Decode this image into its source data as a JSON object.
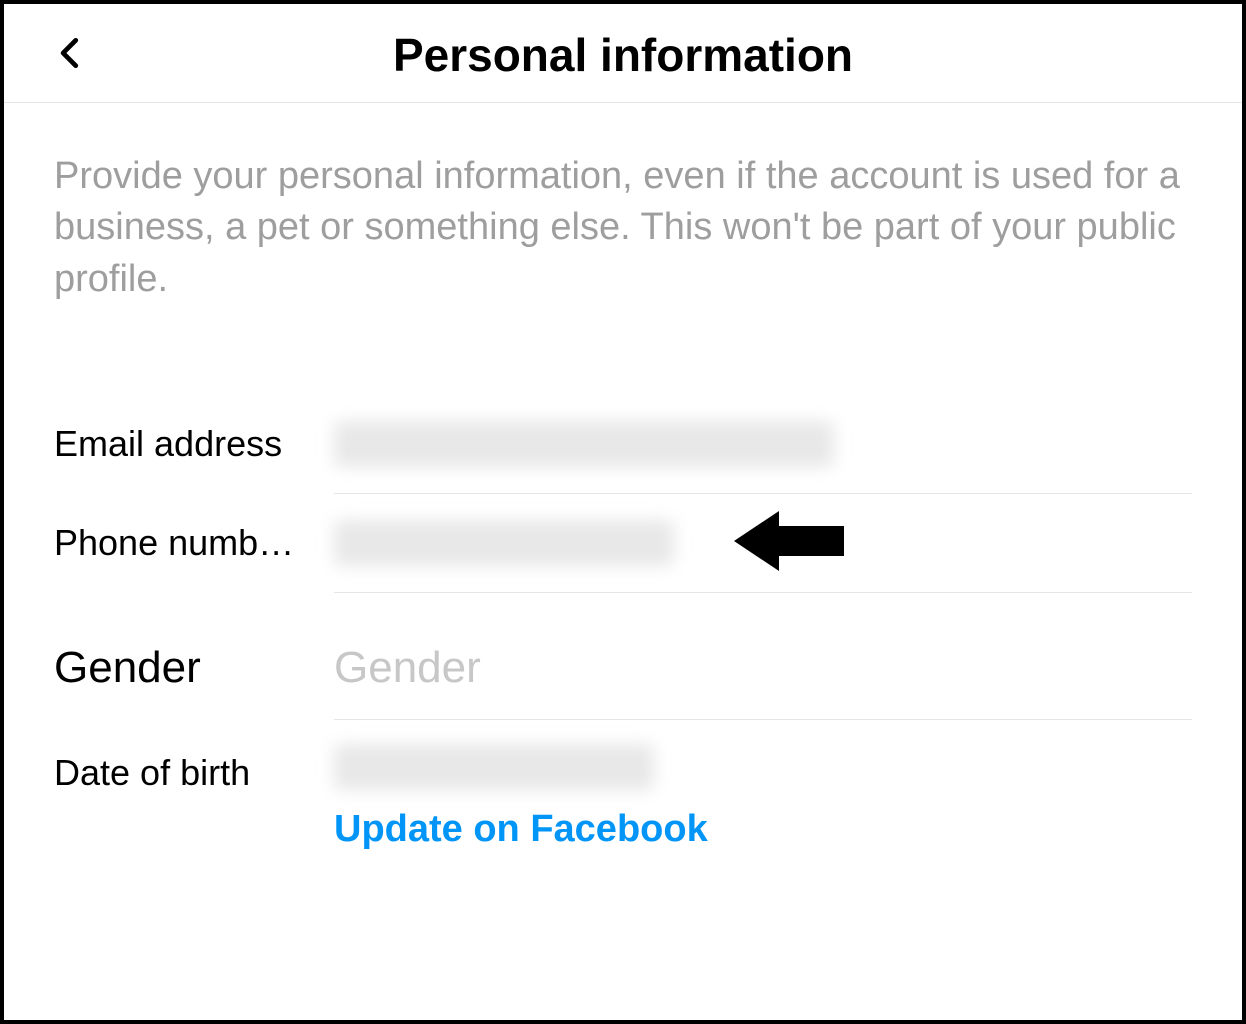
{
  "header": {
    "title": "Personal information"
  },
  "description": "Provide your personal information, even if the account is used for a business, a pet or something else. This won't be part of your public profile.",
  "fields": {
    "email": {
      "label": "Email address"
    },
    "phone": {
      "label": "Phone numb…"
    },
    "gender": {
      "label": "Gender",
      "placeholder": "Gender"
    },
    "dob": {
      "label": "Date of birth",
      "update_link": "Update on Facebook"
    }
  }
}
